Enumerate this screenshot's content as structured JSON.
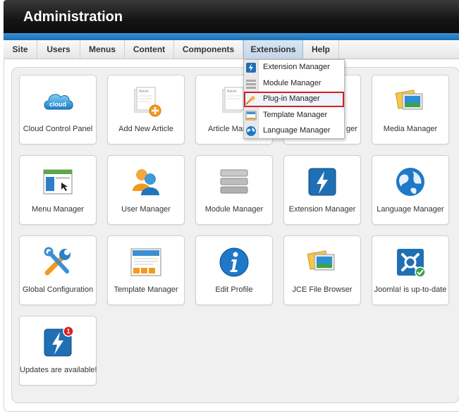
{
  "header": {
    "title": "Administration"
  },
  "menu": {
    "items": [
      {
        "label": "Site"
      },
      {
        "label": "Users"
      },
      {
        "label": "Menus"
      },
      {
        "label": "Content"
      },
      {
        "label": "Components"
      },
      {
        "label": "Extensions"
      },
      {
        "label": "Help"
      }
    ],
    "active": "Extensions"
  },
  "dropdown": {
    "items": [
      {
        "label": "Extension Manager",
        "icon": "lightning-icon"
      },
      {
        "label": "Module Manager",
        "icon": "module-icon"
      },
      {
        "label": "Plug-in Manager",
        "icon": "plug-icon"
      },
      {
        "label": "Template Manager",
        "icon": "template-icon"
      },
      {
        "label": "Language Manager",
        "icon": "globe-icon"
      }
    ],
    "highlighted": "Plug-in Manager"
  },
  "tiles": [
    {
      "label": "Cloud Control Panel",
      "icon": "cloud-icon",
      "icon_text": "cloud"
    },
    {
      "label": "Add New Article",
      "icon": "add-article-icon",
      "icon_text": "Article"
    },
    {
      "label": "Article Manager",
      "visible_label": "Article Man",
      "icon": "article-icon",
      "icon_text": "Article"
    },
    {
      "label": "Category Manager",
      "visible_label": "ger",
      "icon": "category-icon"
    },
    {
      "label": "Media Manager",
      "icon": "media-icon"
    },
    {
      "label": "Menu Manager",
      "icon": "menu-icon"
    },
    {
      "label": "User Manager",
      "icon": "users-icon"
    },
    {
      "label": "Module Manager",
      "icon": "module-icon"
    },
    {
      "label": "Extension Manager",
      "icon": "lightning-icon"
    },
    {
      "label": "Language Manager",
      "icon": "globe-icon"
    },
    {
      "label": "Global Configuration",
      "icon": "tools-icon"
    },
    {
      "label": "Template Manager",
      "icon": "template-icon"
    },
    {
      "label": "Edit Profile",
      "icon": "info-icon"
    },
    {
      "label": "JCE File Browser",
      "icon": "file-browser-icon"
    },
    {
      "label": "Joomla! is up-to-date",
      "icon": "joomla-check-icon"
    },
    {
      "label": "Updates are available!",
      "icon": "update-alert-icon",
      "badge": "1"
    }
  ],
  "colors": {
    "header_bg": "#151515",
    "accent_blue": "#1a6fb5",
    "highlight_border": "#d42020",
    "panel_bg": "#f0f0f0"
  }
}
